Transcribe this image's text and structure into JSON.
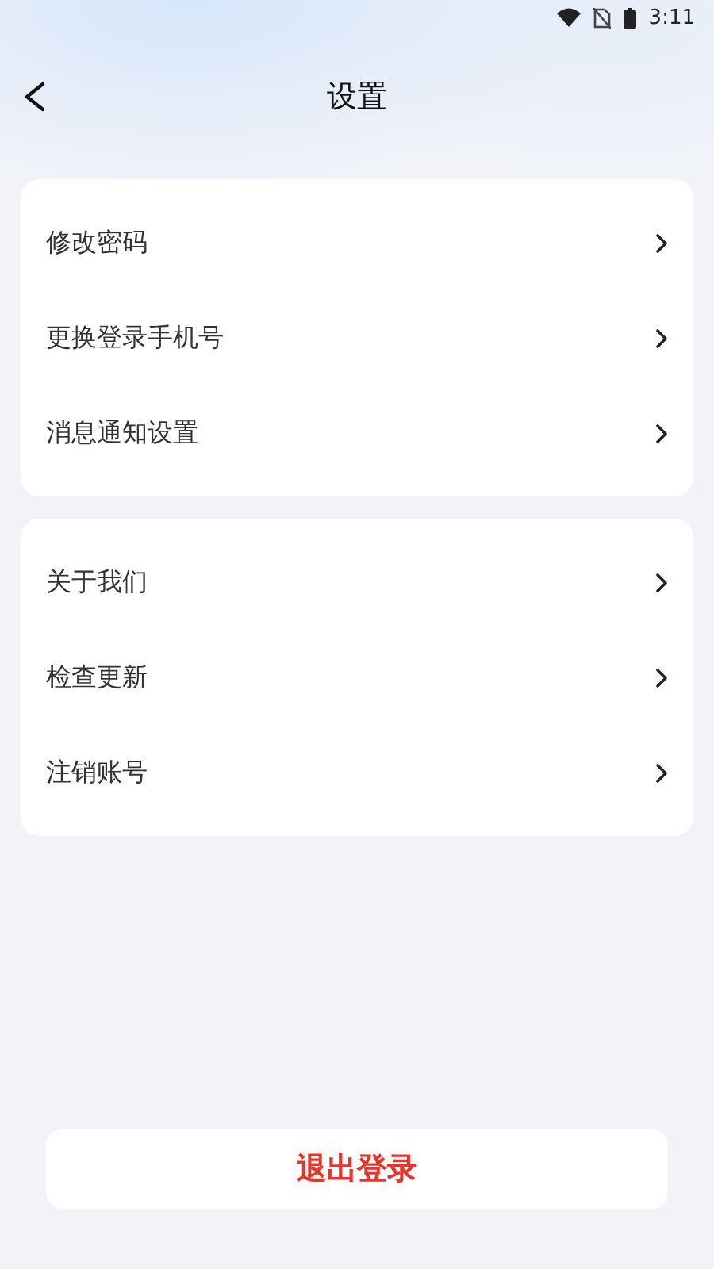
{
  "status_bar": {
    "time": "3:11"
  },
  "app_bar": {
    "title": "设置"
  },
  "groups": [
    {
      "items": [
        {
          "label": "修改密码"
        },
        {
          "label": "更换登录手机号"
        },
        {
          "label": "消息通知设置"
        }
      ]
    },
    {
      "items": [
        {
          "label": "关于我们"
        },
        {
          "label": "检查更新"
        },
        {
          "label": "注销账号"
        }
      ]
    }
  ],
  "logout_button": {
    "label": "退出登录"
  }
}
